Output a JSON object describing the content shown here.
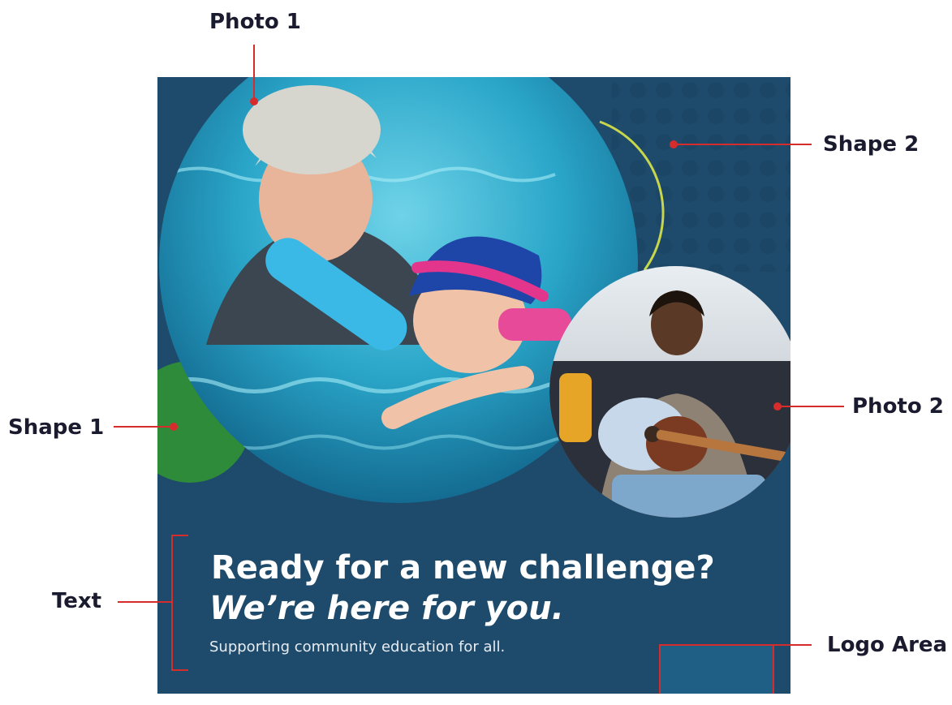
{
  "callouts": {
    "photo1": "Photo 1",
    "shape2": "Shape 2",
    "photo2": "Photo 2",
    "shape1": "Shape 1",
    "text": "Text",
    "logo_area": "Logo Area"
  },
  "poster": {
    "headline_line1": "Ready for a new challenge?",
    "headline_line2": "We’re here for you.",
    "subline": "Supporting community education for all."
  },
  "colors": {
    "poster_bg": "#1e4a6b",
    "shape1_green": "#2e8b3a",
    "shape2_yellow_green": "#c7d64a",
    "callout_red": "#d72c2c",
    "logo_area": "#1f5f86"
  }
}
